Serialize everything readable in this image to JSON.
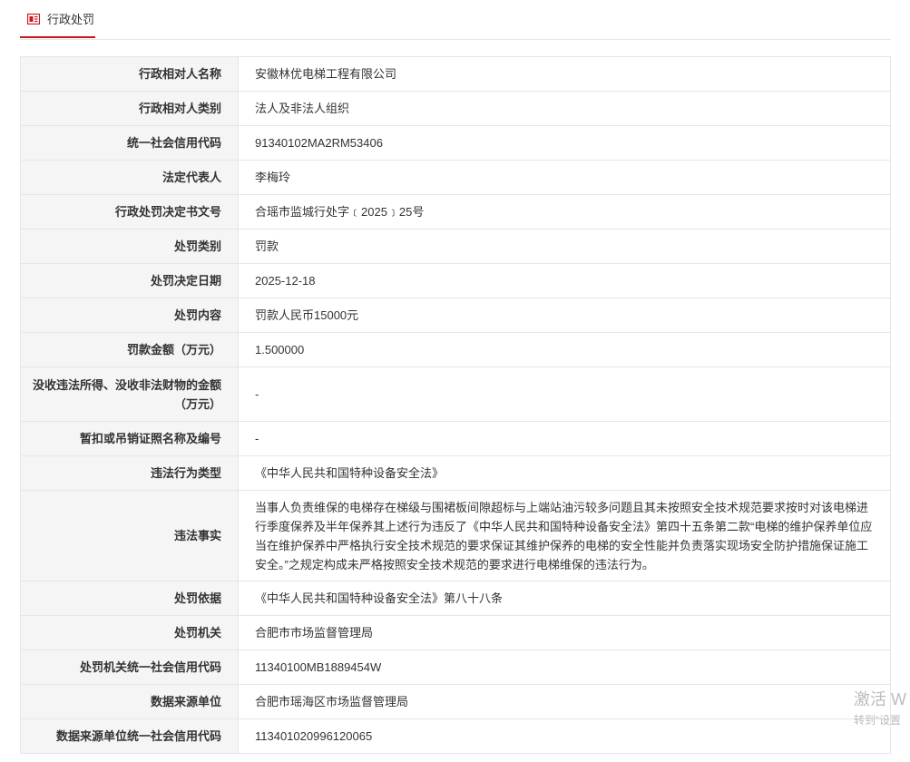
{
  "tab": {
    "label": "行政处罚",
    "accent_color": "#c8161d",
    "icon": "document-icon"
  },
  "rows": [
    {
      "key": "行政相对人名称",
      "value": "安徽林优电梯工程有限公司"
    },
    {
      "key": "行政相对人类别",
      "value": "法人及非法人组织"
    },
    {
      "key": "统一社会信用代码",
      "value": "91340102MA2RM53406"
    },
    {
      "key": "法定代表人",
      "value": "李梅玲"
    },
    {
      "key": "行政处罚决定书文号",
      "value": "合瑶市监城行处字﹝2025﹞25号"
    },
    {
      "key": "处罚类别",
      "value": "罚款"
    },
    {
      "key": "处罚决定日期",
      "value": "2025-12-18"
    },
    {
      "key": "处罚内容",
      "value": "罚款人民币15000元"
    },
    {
      "key": "罚款金额（万元）",
      "value": "1.500000"
    },
    {
      "key": "没收违法所得、没收非法财物的金额（万元）",
      "value": "-"
    },
    {
      "key": "暂扣或吊销证照名称及编号",
      "value": "-"
    },
    {
      "key": "违法行为类型",
      "value": "《中华人民共和国特种设备安全法》"
    },
    {
      "key": "违法事实",
      "value": "当事人负责维保的电梯存在梯级与围裙板间隙超标与上端站油污较多问题且其未按照安全技术规范要求按时对该电梯进行季度保养及半年保养其上述行为违反了《中华人民共和国特种设备安全法》第四十五条第二款“电梯的维护保养单位应当在维护保养中严格执行安全技术规范的要求保证其维护保养的电梯的安全性能并负责落实现场安全防护措施保证施工安全。”之规定构成未严格按照安全技术规范的要求进行电梯维保的违法行为。"
    },
    {
      "key": "处罚依据",
      "value": "《中华人民共和国特种设备安全法》第八十八条"
    },
    {
      "key": "处罚机关",
      "value": "合肥市市场监督管理局"
    },
    {
      "key": "处罚机关统一社会信用代码",
      "value": "11340100MB1889454W"
    },
    {
      "key": "数据来源单位",
      "value": "合肥市瑶海区市场监督管理局"
    },
    {
      "key": "数据来源单位统一社会信用代码",
      "value": "113401020996120065"
    }
  ],
  "watermark": {
    "line1": "激活 W",
    "line2": "转到“设置"
  }
}
